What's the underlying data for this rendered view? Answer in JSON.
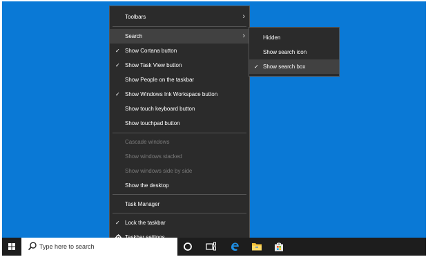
{
  "menu": {
    "items": [
      {
        "label": "Toolbars",
        "checked": false,
        "submenu": true,
        "disabled": false
      },
      {
        "label": "Search",
        "checked": false,
        "submenu": true,
        "disabled": false,
        "hover": true
      },
      {
        "label": "Show Cortana button",
        "checked": true,
        "submenu": false,
        "disabled": false
      },
      {
        "label": "Show Task View button",
        "checked": true,
        "submenu": false,
        "disabled": false
      },
      {
        "label": "Show People on the taskbar",
        "checked": false,
        "submenu": false,
        "disabled": false
      },
      {
        "label": "Show Windows Ink Workspace button",
        "checked": true,
        "submenu": false,
        "disabled": false
      },
      {
        "label": "Show touch keyboard button",
        "checked": false,
        "submenu": false,
        "disabled": false
      },
      {
        "label": "Show touchpad button",
        "checked": false,
        "submenu": false,
        "disabled": false
      },
      {
        "label": "Cascade windows",
        "checked": false,
        "submenu": false,
        "disabled": true
      },
      {
        "label": "Show windows stacked",
        "checked": false,
        "submenu": false,
        "disabled": true
      },
      {
        "label": "Show windows side by side",
        "checked": false,
        "submenu": false,
        "disabled": true
      },
      {
        "label": "Show the desktop",
        "checked": false,
        "submenu": false,
        "disabled": false
      },
      {
        "label": "Task Manager",
        "checked": false,
        "submenu": false,
        "disabled": false
      },
      {
        "label": "Lock the taskbar",
        "checked": true,
        "submenu": false,
        "disabled": false
      },
      {
        "label": "Taskbar settings",
        "checked": false,
        "submenu": false,
        "disabled": false,
        "icon": "gear-icon"
      }
    ],
    "check_glyph": "✓",
    "chevron_glyph": "›"
  },
  "submenu": {
    "items": [
      {
        "label": "Hidden",
        "checked": false
      },
      {
        "label": "Show search icon",
        "checked": false
      },
      {
        "label": "Show search box",
        "checked": true,
        "hover": true
      }
    ]
  },
  "taskbar": {
    "search_placeholder": "Type here to search",
    "icons": [
      "windows-logo-icon",
      "search-icon",
      "cortana-icon",
      "task-view-icon",
      "edge-icon",
      "file-explorer-icon",
      "store-icon"
    ]
  },
  "colors": {
    "desktop": "#0a79d6",
    "menu_bg": "#2b2b2b",
    "taskbar_bg": "#1d1d1d",
    "accent": "#0078d7"
  }
}
